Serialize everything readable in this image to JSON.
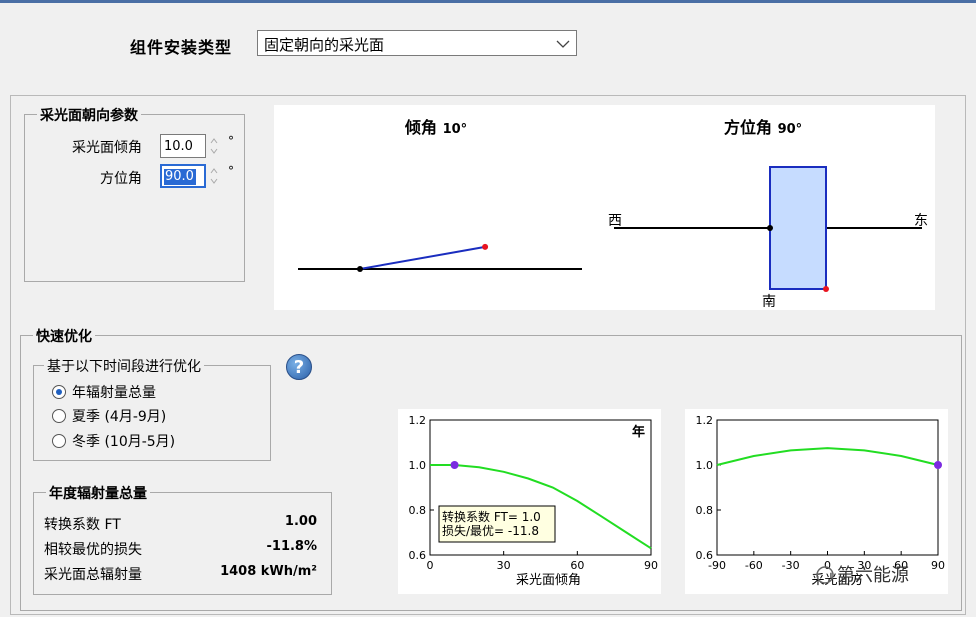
{
  "install_type": {
    "label": "组件安装类型",
    "value": "固定朝向的采光面"
  },
  "orientation": {
    "title": "采光面朝向参数",
    "tilt_label": "采光面倾角",
    "tilt_value": "10.0",
    "azimuth_label": "方位角",
    "azimuth_value": "90.0",
    "unit": "°"
  },
  "tilt_diagram": {
    "title": "倾角",
    "value": "10°",
    "angle_deg": 10
  },
  "azimuth_diagram": {
    "title": "方位角",
    "value": "90°",
    "west": "西",
    "east": "东",
    "south": "南"
  },
  "quick_opt": {
    "title": "快速优化",
    "period_title": "基于以下时间段进行优化",
    "options": [
      {
        "label": "年辐射量总量",
        "selected": true
      },
      {
        "label": "夏季 (4月-9月)",
        "selected": false
      },
      {
        "label": "冬季 (10月-5月)",
        "selected": false
      }
    ],
    "help": "?"
  },
  "annual": {
    "title": "年度辐射量总量",
    "rows": [
      {
        "label": "转换系数 FT",
        "value": "1.00"
      },
      {
        "label": "相较最优的损失",
        "value": "-11.8%"
      },
      {
        "label": "采光面总辐射量",
        "value": "1408 kWh/m²"
      }
    ]
  },
  "colors": {
    "accent": "#2a6ad4",
    "curve": "#22dd22",
    "marker": "#7b2be0",
    "tilt_line": "#1a2dbf",
    "panel_fill": "#c6dcff",
    "panel_stroke": "#1a2dbf",
    "endpoint": "#e8131f"
  },
  "chart_data": [
    {
      "type": "line",
      "xlabel": "采光面倾角",
      "corner_label": "年",
      "xlim": [
        0,
        90
      ],
      "ylim": [
        0.6,
        1.2
      ],
      "x_ticks": [
        "0",
        "30",
        "60",
        "90"
      ],
      "y_ticks": [
        "1.2",
        "1.0",
        "0.8",
        "0.6"
      ],
      "series": [
        {
          "x": [
            0,
            10,
            20,
            30,
            40,
            50,
            60,
            70,
            80,
            90
          ],
          "y": [
            1.0,
            1.0,
            0.99,
            0.97,
            0.94,
            0.9,
            0.84,
            0.77,
            0.7,
            0.63
          ]
        }
      ],
      "marker": {
        "x": 10,
        "y": 1.0
      },
      "annotation": [
        "转换系数 FT= 1.0",
        "损失/最优= -11.8"
      ]
    },
    {
      "type": "line",
      "xlabel": "采光面方",
      "watermark": "第六能源",
      "xlim": [
        -90,
        90
      ],
      "ylim": [
        0.6,
        1.2
      ],
      "x_ticks": [
        "-90",
        "-60",
        "-30",
        "0",
        "30",
        "60",
        "90"
      ],
      "y_ticks": [
        "1.2",
        "1.0",
        "0.8",
        "0.6"
      ],
      "series": [
        {
          "x": [
            -90,
            -60,
            -30,
            0,
            30,
            60,
            90
          ],
          "y": [
            1.0,
            1.04,
            1.065,
            1.075,
            1.065,
            1.04,
            1.0
          ]
        }
      ],
      "marker": {
        "x": 90,
        "y": 1.0
      }
    }
  ]
}
